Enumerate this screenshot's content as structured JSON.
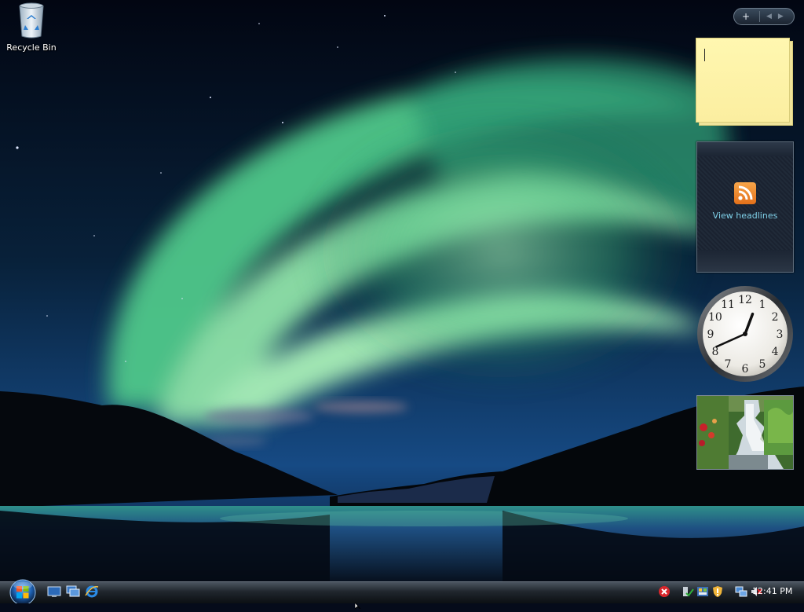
{
  "desktop": {
    "icons": [
      {
        "label": "Recycle Bin",
        "icon": "recycle-bin-icon"
      }
    ]
  },
  "sidebar": {
    "controls": {
      "add_label": "+",
      "prev_icon": "chevron-left-icon",
      "next_icon": "chevron-right-icon"
    },
    "gadgets": {
      "notes": {
        "text": ""
      },
      "feed_headlines": {
        "label": "View headlines",
        "icon": "rss-icon",
        "accent": "#f09030"
      },
      "clock": {
        "time": "12:41",
        "numerals": [
          "12",
          "1",
          "2",
          "3",
          "4",
          "5",
          "6",
          "7",
          "8",
          "9",
          "10",
          "11"
        ]
      },
      "slideshow": {
        "subject": "waterfall garden photo"
      }
    }
  },
  "taskbar": {
    "start_icon": "windows-start-orb-icon",
    "quick_launch": [
      "show-desktop-icon",
      "switch-windows-icon",
      "internet-explorer-icon"
    ],
    "tray_icons": [
      "security-alert-icon",
      "network-check-icon",
      "windows-sidebar-icon",
      "windows-defender-icon",
      "network-icon",
      "volume-muted-icon"
    ],
    "clock": "12:41 PM"
  }
}
